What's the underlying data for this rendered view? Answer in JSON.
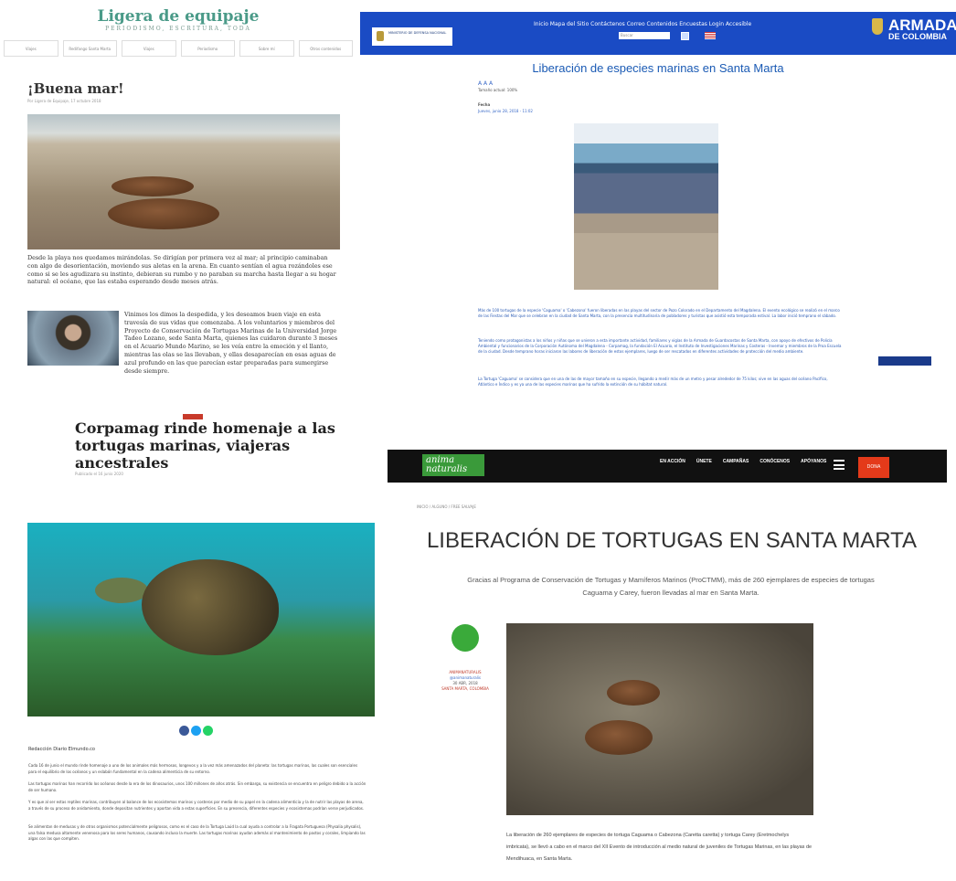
{
  "q1": {
    "blog_title": "Ligera de equipaje",
    "blog_subtitle": "PERIODISMO, ESCRITURA, TODA",
    "nav": [
      "Viajes",
      "Redifango Santa Marta",
      "Viajes",
      "Periodismo",
      "Sobre mí",
      "Otros contenidos"
    ],
    "post_title": "¡Buena mar!",
    "post_date": "Por Ligera de Equipaje, 17 octubre 2018",
    "para1": "Desde la playa nos quedamos mirándolas. Se dirigían por primera vez al mar; al principio caminaban con algo de desorientación, moviendo sus aletas en la arena. En cuanto sentían el agua rozándoles ese como si se les agudizara su instinto, debieran su rumbo y no paraban su marcha hasta llegar a su hogar natural: el océano, que las estaba esperando desde meses atrás.",
    "para2": "Vinimos los dimos la despedida, y les deseamos buen viaje en esta travesía de sus vidas que comenzaba. A los voluntarios y miembros del Proyecto de Conservación de Tortugas Marinas de la Universidad Jorge Tadeo Lozano, sede Santa Marta, quienes las cuidaron durante 3 meses en el Acuario Mundo Marino, se les veía entre la emoción y el llanto, mientras las olas se las llevaban, y ellas desaparecían en esas aguas de azul profundo en las que parecían estar preparadas para sumergirse desde siempre."
  },
  "q2": {
    "ministry": "MINISTERIO DE DEFENSA NACIONAL",
    "topnav": "Inicio   Mapa del Sitio   Contáctenos   Correo   Contenidos   Encuestas   Login   Accesible",
    "search_placeholder": "Buscar",
    "brand_line1": "ARMADA",
    "brand_line2": "DE COLOMBIA",
    "title": "Liberación de especies marinas en Santa Marta",
    "text_size": "Tamaño actual: 100%",
    "date_label": "Fecha",
    "date_value": "Jueves, junio 28, 2018 - 11:02",
    "body1": "Más de 100 tortugas de la especie 'Caguama' o 'Cabezona' fueron liberadas en las playas del sector de Pozo Colorado en el Departamento del Magdalena. El evento ecológico se realizó en el marco de las Fiestas del Mar que se celebran en la ciudad de Santa Marta, con la presencia multitudinaria de pobladores y turistas que asistió esta temporada estival. La labor inició temprano el sábado.",
    "body2": "Teniendo como protagonistas a los niños y niñas que se unieron a esta importante actividad, familiares y vigías de la Armada de Guardacostas de Santa Marta, con apoyo de efectivos de Policía Ambiental y funcionarios de la Corporación Autónoma del Magdalena - Corpamag, la fundación El Acuario, el Instituto de Investigaciones Marinas y Costeras - Invemar y miembros de la Proa Escuela de la ciudad. Desde temprano horas iniciaron las labores de liberación de estos ejemplares, luego de ser rescatados en diferentes actividades de protección del medio ambiente.",
    "body3": "La Tortuga 'Caguama' se considera que en una de las de mayor tamaño en su especie, llegando a medir más de un metro y pesar alrededor de 75 kilos; vive en las aguas del océano Pacífico, Atlántico e Índico y es ya una de las especies marinas que ha sufrido la extinción de su hábitat natural."
  },
  "q3": {
    "title": "Corpamag rinde homenaje a las tortugas marinas, viajeras ancestrales",
    "date": "Publicado el 16 junio 2020",
    "byline": "Redacción Diario Elmundo.co",
    "p1": "Cada 16 de junio el mundo rinde homenaje a uno de los animales más hermosos, longevos y a la vez más amenazados del planeta: las tortugas marinas, las cuales son esenciales para el equilibrio de los océanos y un eslabón fundamental en la cadena alimenticia de su entorno.",
    "p2": "Las tortugas marinas han recorrido los océanos desde la era de los dinosaurios, unos 100 millones de años atrás. Sin embargo, su existencia se encuentra en peligro debido a la acción de ser humano.",
    "p3": "Y es que al ser estas reptiles marinas, contribuyen al balance de los ecosistemas marinos y costeros por medio de su papel en la cadena alimenticia y la de nutrir las playas de arena, a través de su proceso de anidamiento, donde depositan nutrientes y aportan vida a estas superficies. En su presencia, diferentes especies y ecosistemas podrían verse perjudicados.",
    "p4": "Se alimentan de medusas y de otros organismos potencialmente peligrosos, como es el caso de la Tortuga Laúd la cual ayuda a controlar a la Fragata Portuguesa (Physalia physalis), una falsa medusa altamente venenosa para los seres humanos, causando incluso la muerte. Las tortugas marinas ayudan además al mantenimiento de pastos y corales, limpiando las algas con las que compiten.",
    "colors": {
      "fb": "#3b5998",
      "tw": "#1da1f2",
      "wa": "#25d366"
    }
  },
  "q4": {
    "logo": "anima naturalis",
    "nav": [
      "EN ACCIÓN",
      "ÚNETE",
      "CAMPAÑAS",
      "CONÓCENOS",
      "APÓYANOS"
    ],
    "donate": "DONA",
    "breadcrumb": "INICIO  /  ALGUNO  /  FREE SALVAJE",
    "title": "LIBERACIÓN DE TORTUGAS EN SANTA MARTA",
    "subtitle": "Gracias al Programa de Conservación de Tortugas y Mamíferos Marinos (ProCTMM), más de 260 ejemplares de especies de tortugas Caguama y Carey, fueron llevadas al mar en Santa Marta.",
    "author": "ANIMANATURALIS",
    "handle": "@animanaturalis",
    "date": "30 ABR, 2018",
    "place": "SANTA MARTA, COLOMBIA",
    "caption": "La liberación de 260 ejemplares de especies de tortuga Caguama o Cabezona (Caretta caretta) y tortuga Carey (Eretmochelys imbricata), se llevó a cabo en el marco del XII Evento de introducción al medio natural de juveniles de Tortugas Marinas, en las playas de Mendihuaca, en Santa Marta.",
    "accent": "#e43a1a"
  }
}
